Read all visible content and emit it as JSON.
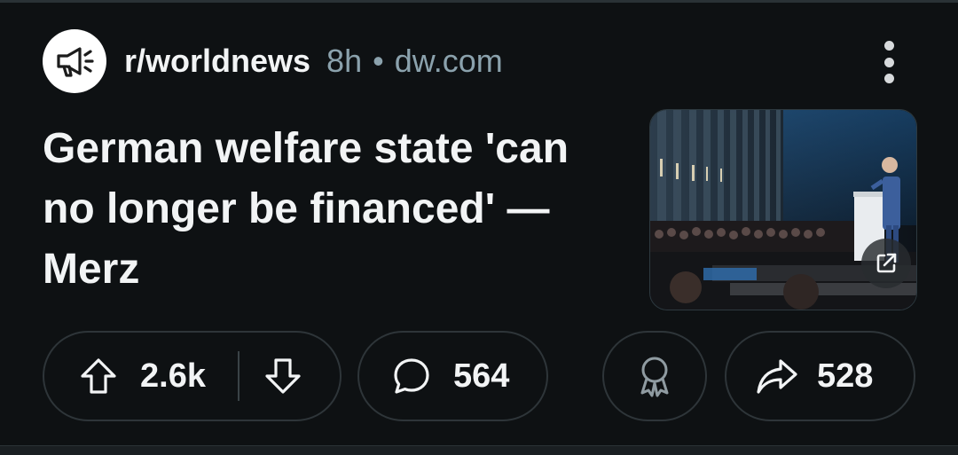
{
  "post": {
    "subreddit": "r/worldnews",
    "time": "8h",
    "separator": "•",
    "domain": "dw.com",
    "title": "German welfare state 'can no longer be financed' — Merz",
    "thumbnail_icon": "external-link-icon"
  },
  "actions": {
    "upvotes": "2.6k",
    "comments": "564",
    "shares": "528"
  },
  "colors": {
    "background": "#0e1113",
    "text": "#f2f4f5",
    "meta_text": "#8ba2ad",
    "pill_border": "#2e3539"
  }
}
